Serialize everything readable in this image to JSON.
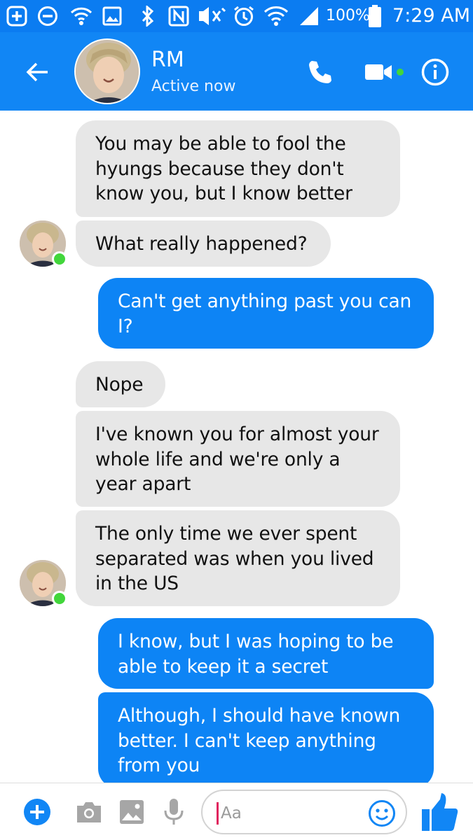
{
  "status_bar": {
    "battery": "100%",
    "time": "7:29 AM",
    "icons": [
      "plus-box-icon",
      "minus-circle-icon",
      "wifi-call-icon",
      "image-icon",
      "bluetooth-icon",
      "nfc-icon",
      "mute-icon",
      "alarm-icon",
      "wifi-icon",
      "signal-icon",
      "battery-icon"
    ]
  },
  "header": {
    "contact_name": "RM",
    "presence": "Active now",
    "icons": [
      "back-arrow-icon",
      "phone-icon",
      "video-camera-icon",
      "info-icon"
    ],
    "accent_color": "#1186f5"
  },
  "messages": [
    {
      "from": "RM",
      "text": "You may be able to fool the hyungs because they don't know you, but I know better"
    },
    {
      "from": "RM",
      "text": "What really happened?"
    },
    {
      "from": "me",
      "text": "Can't get anything past you can I?"
    },
    {
      "from": "RM",
      "text": "Nope"
    },
    {
      "from": "RM",
      "text": "I've known you for almost your whole life and we're only a year apart"
    },
    {
      "from": "RM",
      "text": "The only time we ever spent separated was when you lived in the US"
    },
    {
      "from": "me",
      "text": "I know, but I was hoping to be able to keep it a secret"
    },
    {
      "from": "me",
      "text": "Although, I should have known better. I can't keep anything from you"
    }
  ],
  "composer": {
    "placeholder": "Aa",
    "icons": [
      "plus-circle-icon",
      "camera-icon",
      "gallery-icon",
      "microphone-icon",
      "emoji-icon",
      "thumbs-up-icon"
    ]
  },
  "colors": {
    "incoming_bubble": "#e7e7e7",
    "outgoing_bubble": "#0d84f5",
    "online": "#42d63b"
  }
}
